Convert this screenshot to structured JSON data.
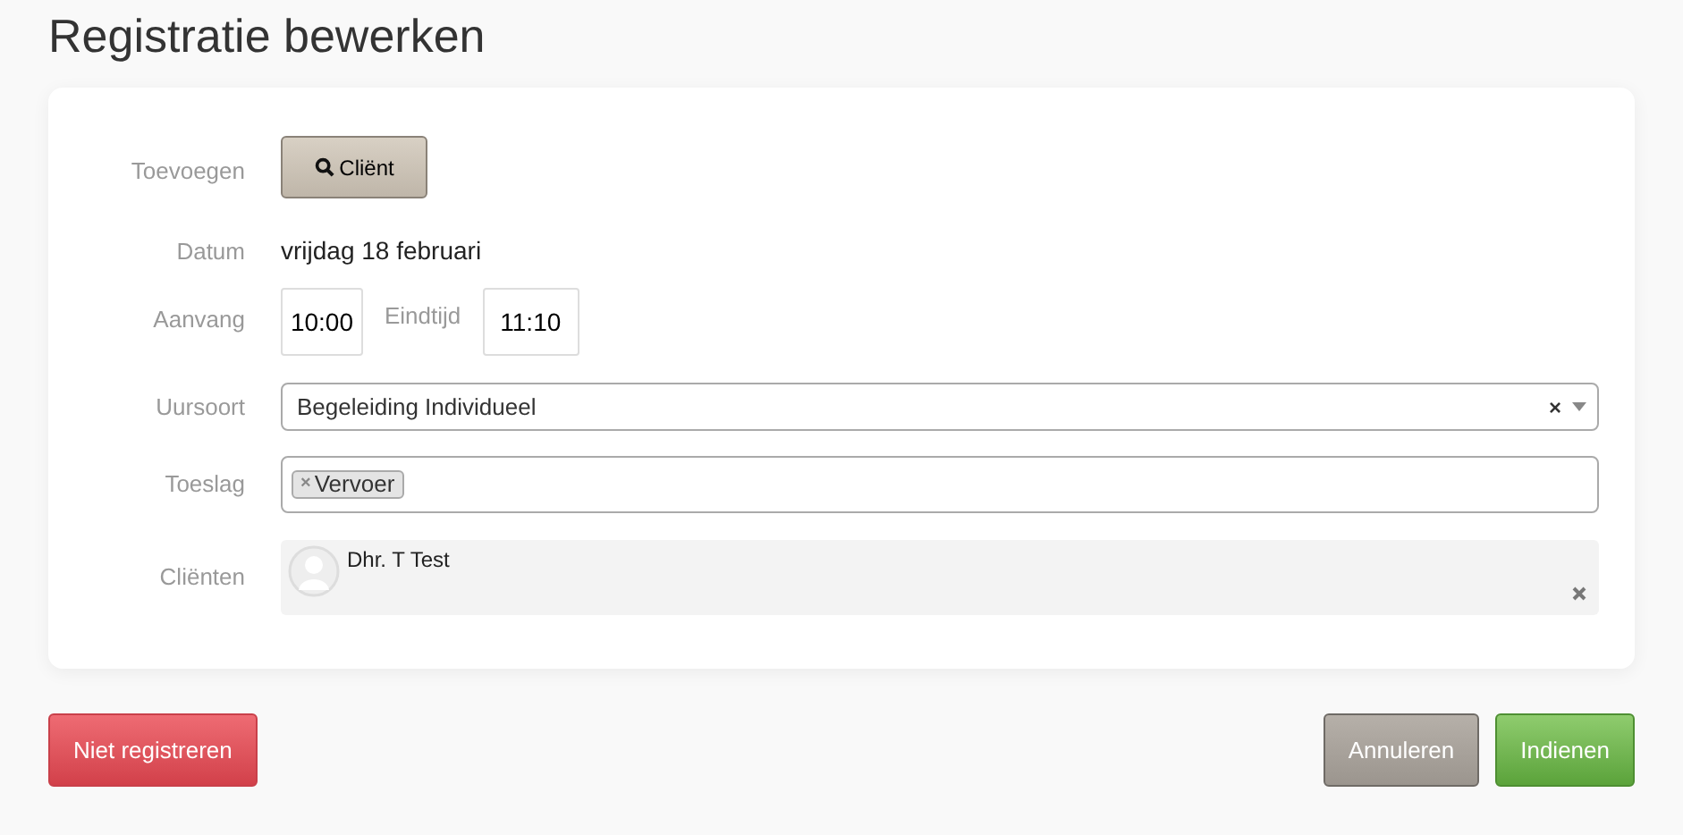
{
  "title": "Registratie bewerken",
  "add": {
    "label": "Toevoegen",
    "button": "Cliënt"
  },
  "date": {
    "label": "Datum",
    "value": "vrijdag 18 februari"
  },
  "start": {
    "label": "Aanvang",
    "value": "10:00"
  },
  "end": {
    "label": "Eindtijd",
    "value": "11:10"
  },
  "hour_type": {
    "label": "Uursoort",
    "value": "Begeleiding Individueel",
    "clear": "×"
  },
  "surcharge": {
    "label": "Toeslag",
    "tags": [
      {
        "remove": "×",
        "label": "Vervoer"
      }
    ]
  },
  "clients": {
    "label": "Cliënten",
    "items": [
      {
        "name": "Dhr. T Test"
      }
    ]
  },
  "buttons": [
    {
      "label": "Niet registreren",
      "kind": "danger"
    },
    {
      "label": "Annuleren",
      "kind": "default"
    },
    {
      "label": "Indienen",
      "kind": "success"
    }
  ]
}
